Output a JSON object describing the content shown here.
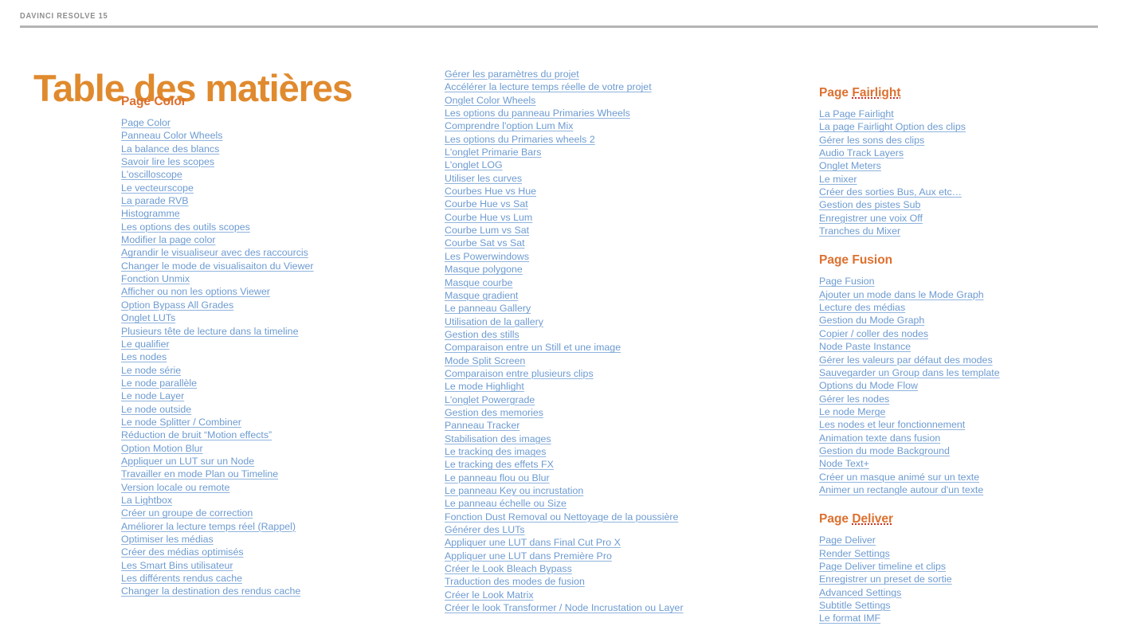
{
  "header": {
    "product_label": "DAVINCI RESOLVE 15"
  },
  "title": "Table des matières",
  "columns": [
    {
      "id": "column-left",
      "sections": [
        {
          "heading": "Page Color",
          "heading_misspelled_part": "",
          "links": [
            "Page Color",
            "Panneau Color Wheels",
            "La balance des blancs",
            "Savoir lire les scopes",
            "L'oscilloscope",
            "Le vecteurscope",
            "La parade RVB",
            "Histogramme",
            "Les options des outils scopes",
            "Modifier la page color",
            "Agrandir le visualiseur avec des raccourcis",
            "Changer le mode de visualisaiton du Viewer",
            "Fonction Unmix",
            "Afficher ou non les options Viewer",
            "Option Bypass All Grades",
            "Onglet LUTs",
            "Plusieurs tête de lecture dans la timeline",
            "Le qualifier",
            "Les nodes",
            "Le node série",
            "Le node parallèle",
            "Le node Layer",
            "Le node outside",
            "Le node Splitter / Combiner",
            "Réduction de bruit “Motion effects”",
            "Option Motion Blur",
            "Appliquer un LUT sur un Node",
            "Travailler en mode Plan ou Timeline",
            "Version locale ou remote",
            "La Lightbox",
            "Créer un groupe de correction",
            "Améliorer la lecture temps réel (Rappel)",
            "Optimiser les médias",
            "Créer des médias optimisés",
            "Les Smart Bins utilisateur",
            "Les différents rendus cache",
            "Changer la destination des rendus cache"
          ]
        }
      ]
    },
    {
      "id": "column-middle",
      "sections": [
        {
          "heading": "",
          "heading_misspelled_part": "",
          "links": [
            "Gérer les paramètres du projet",
            "Accélérer la lecture temps réelle de votre projet",
            "Onglet Color Wheels",
            "Les options du panneau Primaries Wheels",
            "Comprendre l'option Lum Mix",
            "Les options du Primaries wheels 2 ",
            "L'onglet Primarie Bars",
            "L'onglet LOG",
            "Utiliser les curves",
            "Courbes Hue vs Hue",
            "Courbe Hue vs Sat",
            "Courbe Hue vs Lum",
            "Courbe Lum vs Sat",
            "Courbe Sat vs Sat",
            "Les Powerwindows",
            "Masque polygone",
            "Masque courbe",
            "Masque gradient",
            "Le panneau Gallery",
            "Utilisation de la gallery",
            "Gestion des stills",
            "Comparaison entre un Still et une image",
            "Mode Split Screen",
            "Comparaison entre plusieurs clips",
            "Le mode Highlight ",
            "L'onglet Powergrade",
            "Gestion des memories",
            "Panneau Tracker",
            "Stabilisation des images",
            "Le tracking des images",
            "Le tracking des effets FX",
            "Le panneau flou ou Blur",
            "Le panneau Key ou incrustation",
            "Le panneau échelle ou Size",
            "Fonction Dust Removal ou Nettoyage de la poussière",
            "Générer des LUTs",
            "Appliquer une LUT dans Final Cut Pro X",
            "Appliquer une LUT dans Première Pro",
            "Créer le Look Bleach Bypass",
            "Traduction des modes de fusion",
            "Créer le Look Matrix",
            "Créer le look Transformer / Node Incrustation ou Layer"
          ]
        }
      ]
    },
    {
      "id": "column-right",
      "sections": [
        {
          "heading": "Page Fairlight",
          "heading_prefix": "Page ",
          "heading_misspelled_part": "Fairlight",
          "links": [
            "La Page Fairlight",
            "La page Fairlight Option des clips",
            "Gérer les sons des clips",
            "Audio Track Layers",
            "Onglet Meters",
            "Le mixer",
            "Créer des sorties Bus, Aux etc…",
            "Gestion des pistes Sub",
            "Enregistrer une voix Off",
            "Tranches du Mixer"
          ]
        },
        {
          "heading": "Page Fusion",
          "heading_prefix": "Page Fusion",
          "heading_misspelled_part": "",
          "links": [
            "Page Fusion",
            "Ajouter un mode dans le Mode Graph",
            "Lecture des médias",
            "Gestion du Mode Graph",
            "Copier / coller des nodes",
            "Node Paste Instance",
            "Gérer les valeurs par défaut des modes",
            "Sauvegarder un Group dans les template",
            "Options du Mode Flow",
            "Gérer les nodes",
            "Le node Merge",
            "Les nodes et leur fonctionnement",
            "Animation texte dans fusion",
            "Gestion du mode Background",
            "Node Text+",
            "Créer un masque animé sur un texte",
            "Animer un rectangle autour d'un texte"
          ]
        },
        {
          "heading": "Page Deliver",
          "heading_prefix": "Page ",
          "heading_misspelled_part": "Deliver",
          "links": [
            "Page Deliver",
            "Render Settings",
            "Page Deliver timeline et clips ",
            "Enregistrer un preset de sortie",
            "Advanced Settings",
            "Subtitle Settings",
            "Le format IMF"
          ]
        }
      ]
    }
  ],
  "colors": {
    "title_orange": "#e08a2e",
    "heading_orange": "#dd702f",
    "link_blue": "#6d9bd1",
    "rule_gray": "#b4b4b4",
    "header_label_gray": "#8d8d8d",
    "spellcheck_red": "#cc3322"
  }
}
